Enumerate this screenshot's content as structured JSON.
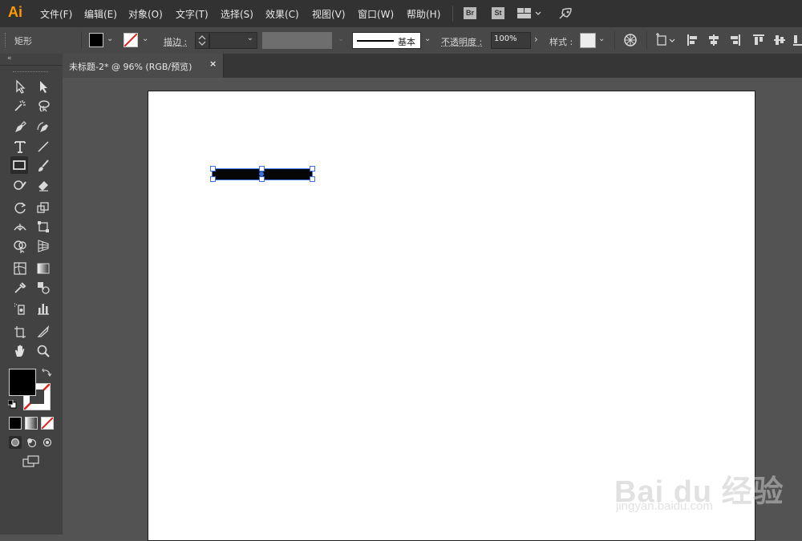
{
  "app": {
    "logo": "Ai"
  },
  "menu": [
    "文件(F)",
    "编辑(E)",
    "对象(O)",
    "文字(T)",
    "选择(S)",
    "效果(C)",
    "视图(V)",
    "窗口(W)",
    "帮助(H)"
  ],
  "menu_badges": [
    "Br",
    "St"
  ],
  "control_bar": {
    "selection_type": "矩形",
    "fill_color": "#000000",
    "stroke_color": "none",
    "stroke_label": "描边 :",
    "stroke_weight": "",
    "stroke_profile": "基本",
    "opacity_label": "不透明度 :",
    "opacity_value": "100%",
    "style_label": "样式 :"
  },
  "document_tab": {
    "title": "未标题-2* @ 96% (RGB/预览)",
    "close_glyph": "×"
  },
  "toolbar": {
    "fill_color": "#000000",
    "stroke_color": "none"
  },
  "watermark": {
    "main": "Bai du 经验",
    "sub": "jingyan.baidu.com"
  },
  "colors": {
    "accent": "#ff9a00",
    "selection": "#3d6fe0",
    "artboard": "#ffffff",
    "workspace": "#535353"
  }
}
